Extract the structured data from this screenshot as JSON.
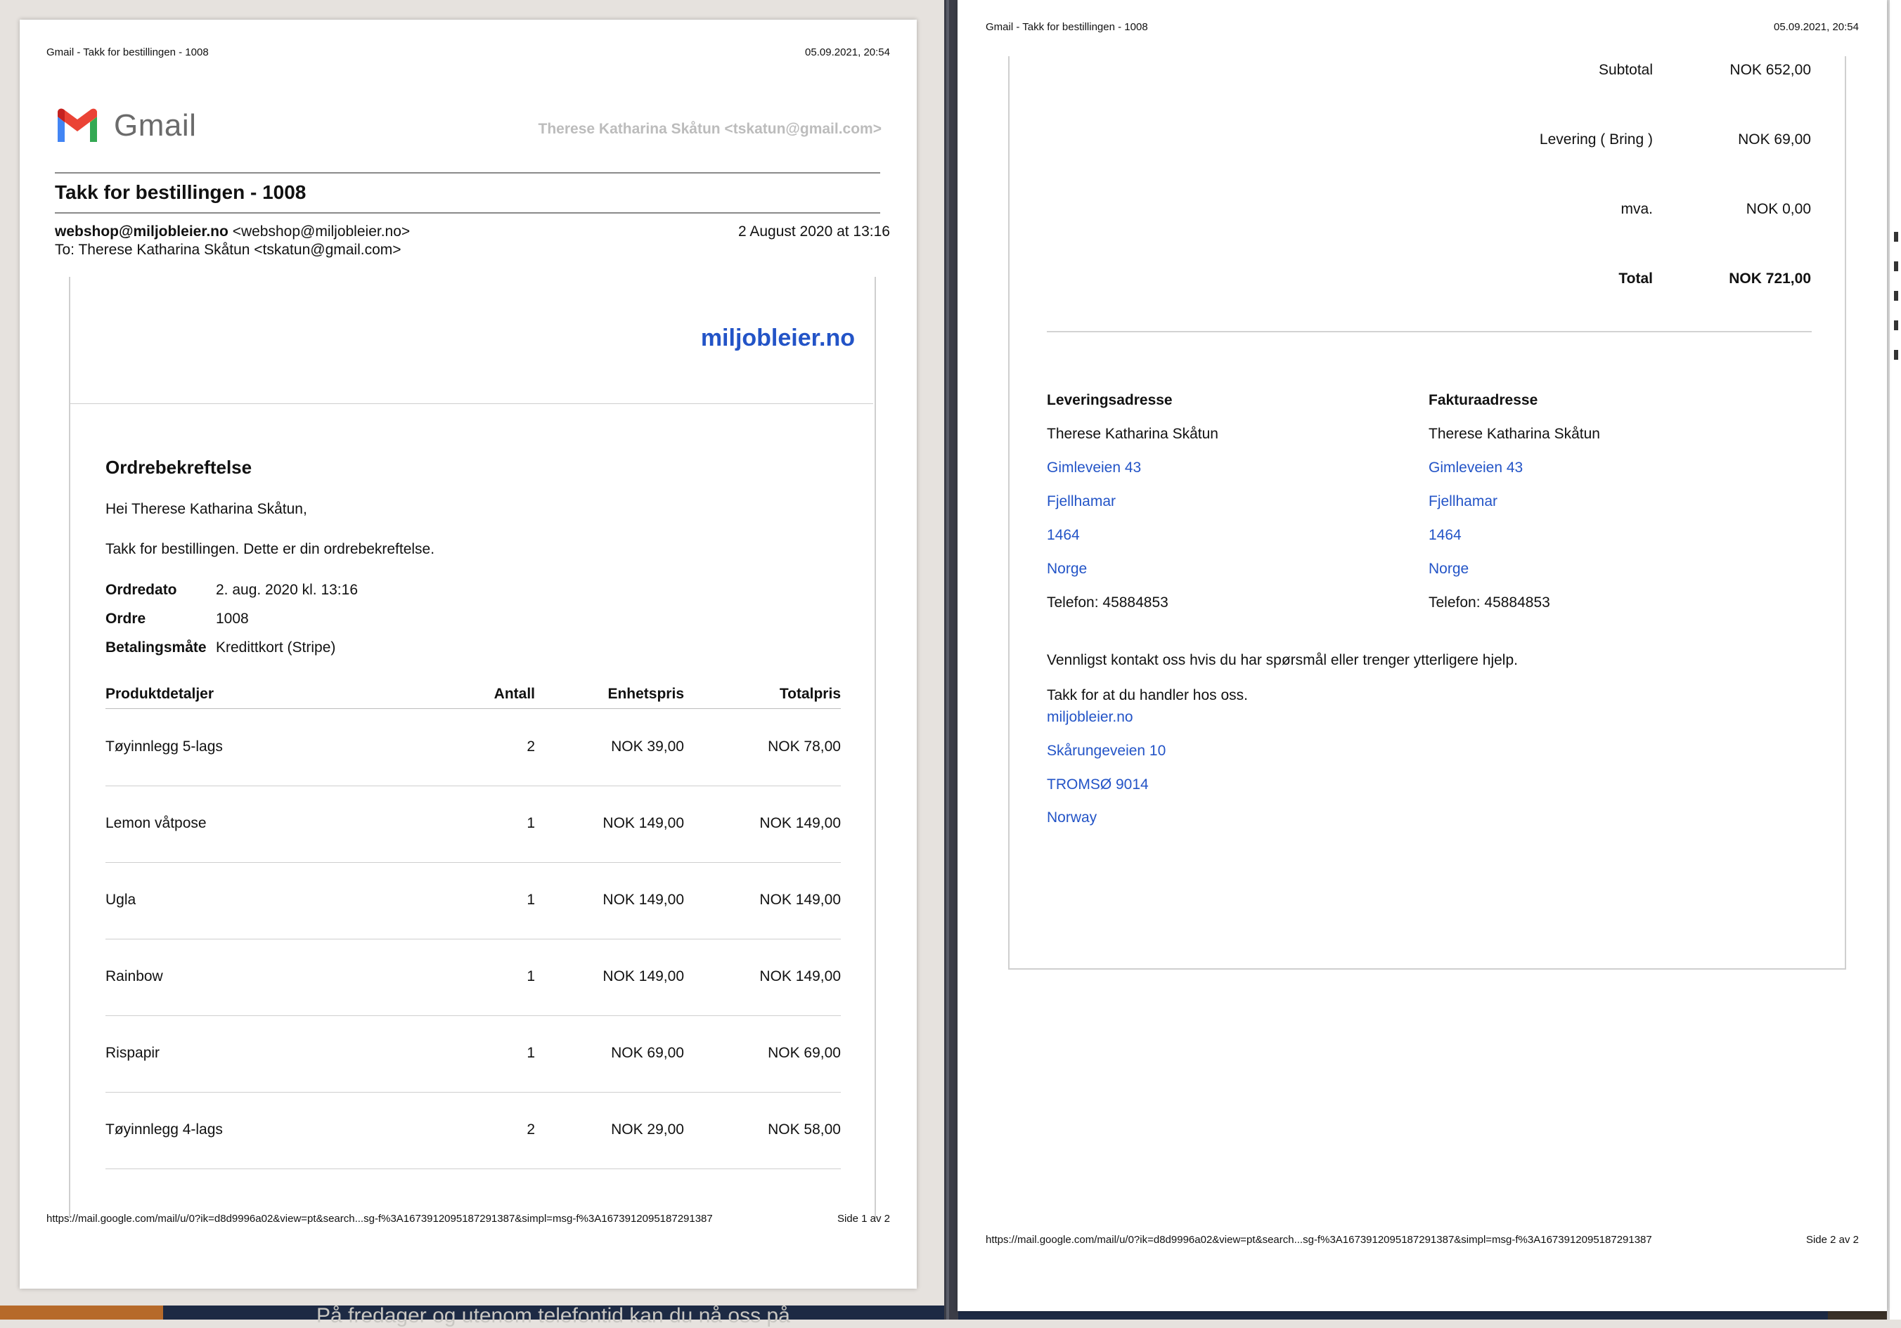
{
  "background_text": "På fredager og utenom telefontid kan du nå oss på",
  "print_header": {
    "title": "Gmail - Takk for bestillingen - 1008",
    "datetime": "05.09.2021, 20:54"
  },
  "gmail": {
    "logo_text": "Gmail",
    "account": "Therese Katharina Skåtun <tskatun@gmail.com>"
  },
  "email": {
    "subject": "Takk for bestillingen - 1008",
    "from_name": "webshop@miljobleier.no",
    "from_addr": "<webshop@miljobleier.no>",
    "date": "2 August 2020 at 13:16",
    "to": "To: Therese Katharina Skåtun <tskatun@gmail.com>"
  },
  "shop": {
    "name": "miljobleier.no"
  },
  "order": {
    "heading": "Ordrebekreftelse",
    "greeting": "Hei Therese Katharina Skåtun,",
    "intro": "Takk for bestillingen. Dette er din ordrebekreftelse.",
    "details": [
      {
        "label": "Ordredato",
        "value": "2. aug. 2020 kl. 13:16"
      },
      {
        "label": "Ordre",
        "value": "1008"
      },
      {
        "label": "Betalingsmåte",
        "value": "Kredittkort (Stripe)"
      }
    ],
    "table_headers": {
      "product": "Produktdetaljer",
      "qty": "Antall",
      "unit": "Enhetspris",
      "total": "Totalpris"
    },
    "items": [
      {
        "name": "Tøyinnlegg 5-lags",
        "qty": "2",
        "unit": "NOK 39,00",
        "total": "NOK 78,00"
      },
      {
        "name": "Lemon våtpose",
        "qty": "1",
        "unit": "NOK 149,00",
        "total": "NOK 149,00"
      },
      {
        "name": "Ugla",
        "qty": "1",
        "unit": "NOK 149,00",
        "total": "NOK 149,00"
      },
      {
        "name": "Rainbow",
        "qty": "1",
        "unit": "NOK 149,00",
        "total": "NOK 149,00"
      },
      {
        "name": "Rispapir",
        "qty": "1",
        "unit": "NOK 69,00",
        "total": "NOK 69,00"
      },
      {
        "name": "Tøyinnlegg 4-lags",
        "qty": "2",
        "unit": "NOK 29,00",
        "total": "NOK 58,00"
      }
    ],
    "summary": [
      {
        "label": "Subtotal",
        "value": "NOK 652,00",
        "bold": false
      },
      {
        "label": "Levering ( Bring )",
        "value": "NOK 69,00",
        "bold": false
      },
      {
        "label": "mva.",
        "value": "NOK 0,00",
        "bold": false
      },
      {
        "label": "Total",
        "value": "NOK 721,00",
        "bold": true
      }
    ]
  },
  "shipping_address": {
    "heading": "Leveringsadresse",
    "name": "Therese Katharina Skåtun",
    "street": "Gimleveien 43",
    "city": "Fjellhamar",
    "postcode": "1464",
    "country": "Norge",
    "phone": "Telefon: 45884853"
  },
  "billing_address": {
    "heading": "Fakturaadresse",
    "name": "Therese Katharina Skåtun",
    "street": "Gimleveien 43",
    "city": "Fjellhamar",
    "postcode": "1464",
    "country": "Norge",
    "phone": "Telefon: 45884853"
  },
  "closing": {
    "contact": "Vennligst kontakt oss hvis du har spørsmål eller trenger ytterligere hjelp.",
    "thanks": "Takk for at du handler hos oss.",
    "shop_link": "miljobleier.no",
    "street": "Skårungeveien 10",
    "city": "TROMSØ 9014",
    "country": "Norway"
  },
  "footer": {
    "url": "https://mail.google.com/mail/u/0?ik=d8d9996a02&view=pt&search...sg-f%3A1673912095187291387&simpl=msg-f%3A1673912095187291387",
    "page1": "Side 1 av 2",
    "page2": "Side 2 av 2"
  },
  "colors": {
    "link": "#2354c7",
    "gmail_red": "#ea4335",
    "gmail_blue": "#4285f4",
    "gmail_green": "#34a853",
    "gmail_yellow": "#fbbc04"
  }
}
